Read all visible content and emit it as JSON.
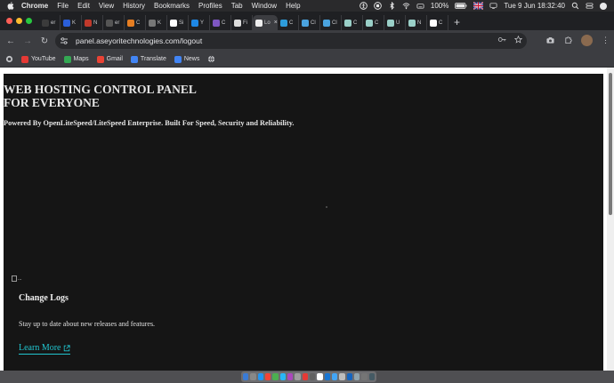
{
  "menubar": {
    "app": "Chrome",
    "menus": [
      "File",
      "Edit",
      "View",
      "History",
      "Bookmarks",
      "Profiles",
      "Tab",
      "Window",
      "Help"
    ],
    "battery": "100%",
    "datetime": "Tue 9 Jun  18:32:40"
  },
  "tabs": [
    {
      "label": "er",
      "color": "#3b3b3b"
    },
    {
      "label": "K",
      "color": "#2b5fd9"
    },
    {
      "label": "N",
      "color": "#c0392b"
    },
    {
      "label": "er",
      "color": "#555555"
    },
    {
      "label": "C",
      "color": "#e67e22"
    },
    {
      "label": "K",
      "color": "#777777"
    },
    {
      "label": "Si",
      "color": "#ffffff"
    },
    {
      "label": "Y",
      "color": "#1e88e5"
    },
    {
      "label": "C",
      "color": "#7e57c2"
    },
    {
      "label": "Fi",
      "color": "#dddddd"
    },
    {
      "label": "Lo",
      "color": "#eeeeee",
      "active": true
    },
    {
      "label": "C",
      "color": "#2d9cdb"
    },
    {
      "label": "Cl",
      "color": "#4aa3df"
    },
    {
      "label": "Cl",
      "color": "#4aa3df"
    },
    {
      "label": "C",
      "color": "#9ad0c8"
    },
    {
      "label": "C",
      "color": "#9ad0c8"
    },
    {
      "label": "U",
      "color": "#9ad0c8"
    },
    {
      "label": "N",
      "color": "#9ad0c8"
    },
    {
      "label": "C",
      "color": "#ffffff"
    }
  ],
  "toolbar": {
    "url": "panel.aseyoritechnologies.com/logout"
  },
  "bookmarks": [
    {
      "label": "YouTube",
      "color": "#e53935"
    },
    {
      "label": "Maps",
      "color": "#34a853"
    },
    {
      "label": "Gmail",
      "color": "#ea4335"
    },
    {
      "label": "Translate",
      "color": "#4285f4"
    },
    {
      "label": "News",
      "color": "#4285f4"
    }
  ],
  "page": {
    "title_line1": "WEB HOSTING CONTROL PANEL",
    "title_line2": "FOR EVERYONE",
    "subtitle": "Powered By OpenLiteSpeed/LiteSpeed Enterprise. Built For Speed, Security and Reliability.",
    "image_alt": "...",
    "changelog_title": "Change Logs",
    "changelog_desc": "Stay up to date about new releases and features.",
    "learn_more": "Learn More"
  },
  "dock": {
    "icon_colors": [
      "#3a7bd5",
      "#888888",
      "#2196f3",
      "#f44336",
      "#4caf50",
      "#29b6f6",
      "#ab47bc",
      "#9e9e9e",
      "#e53935",
      "#616161",
      "#ffffff",
      "#1976d2",
      "#42a5f5",
      "#bdbdbd",
      "#1565c0",
      "#90a4ae",
      "#757575",
      "#455a64"
    ]
  }
}
